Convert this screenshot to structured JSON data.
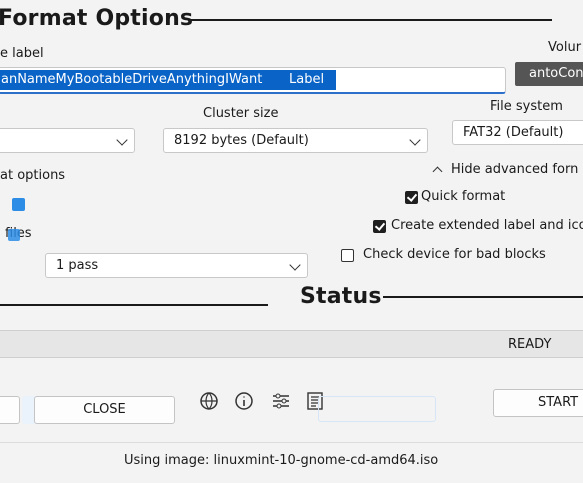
{
  "format_options": {
    "title": "Format Options",
    "volume_label_caption": "e label",
    "volume_label_value": "anNameMyBootableDriveAnythingIWant",
    "volume_label_tail": "Label",
    "file_system_caption": "File system",
    "file_system_value": "FAT32 (Default)",
    "cluster_size_caption": "Cluster size",
    "cluster_size_value": "8192 bytes (Default)",
    "advanced_toggle": "Hide advanced forn",
    "options_caption": "at options",
    "quick_format": "Quick format",
    "extended_label": "Create extended label and ico",
    "files_caption": "files",
    "bad_blocks": "Check device for bad blocks",
    "passes_value": "1 pass"
  },
  "top_right": {
    "volume_caption": "Volur",
    "volume_value": "antoCon"
  },
  "status": {
    "title": "Status",
    "progress_text": "READY"
  },
  "buttons": {
    "close": "CLOSE",
    "start": "START"
  },
  "footer": {
    "image_text": "Using image: linuxmint-10-gnome-cd-amd64.iso"
  },
  "checkboxes": {
    "quick_format": true,
    "extended_label": true,
    "bad_blocks": false
  },
  "colors": {
    "selection": "#0a64c8",
    "accent_blue": "#2c8ce6"
  },
  "icons": [
    "language-icon",
    "info-icon",
    "settings-icon",
    "log-icon"
  ]
}
